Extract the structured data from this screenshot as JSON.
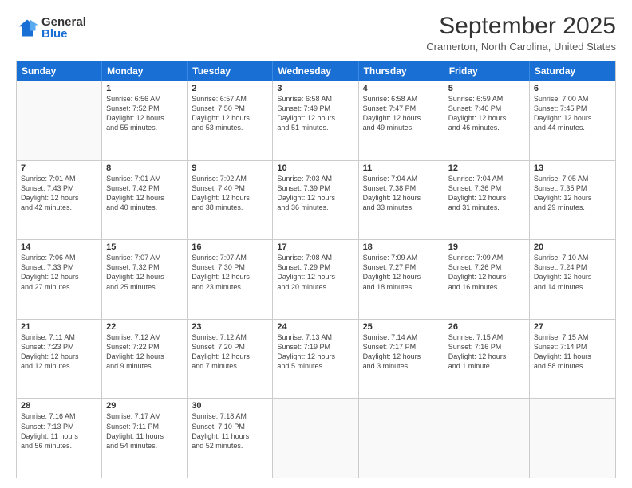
{
  "logo": {
    "general": "General",
    "blue": "Blue"
  },
  "title": "September 2025",
  "subtitle": "Cramerton, North Carolina, United States",
  "weekdays": [
    "Sunday",
    "Monday",
    "Tuesday",
    "Wednesday",
    "Thursday",
    "Friday",
    "Saturday"
  ],
  "weeks": [
    [
      {
        "day": "",
        "lines": []
      },
      {
        "day": "1",
        "lines": [
          "Sunrise: 6:56 AM",
          "Sunset: 7:52 PM",
          "Daylight: 12 hours",
          "and 55 minutes."
        ]
      },
      {
        "day": "2",
        "lines": [
          "Sunrise: 6:57 AM",
          "Sunset: 7:50 PM",
          "Daylight: 12 hours",
          "and 53 minutes."
        ]
      },
      {
        "day": "3",
        "lines": [
          "Sunrise: 6:58 AM",
          "Sunset: 7:49 PM",
          "Daylight: 12 hours",
          "and 51 minutes."
        ]
      },
      {
        "day": "4",
        "lines": [
          "Sunrise: 6:58 AM",
          "Sunset: 7:47 PM",
          "Daylight: 12 hours",
          "and 49 minutes."
        ]
      },
      {
        "day": "5",
        "lines": [
          "Sunrise: 6:59 AM",
          "Sunset: 7:46 PM",
          "Daylight: 12 hours",
          "and 46 minutes."
        ]
      },
      {
        "day": "6",
        "lines": [
          "Sunrise: 7:00 AM",
          "Sunset: 7:45 PM",
          "Daylight: 12 hours",
          "and 44 minutes."
        ]
      }
    ],
    [
      {
        "day": "7",
        "lines": [
          "Sunrise: 7:01 AM",
          "Sunset: 7:43 PM",
          "Daylight: 12 hours",
          "and 42 minutes."
        ]
      },
      {
        "day": "8",
        "lines": [
          "Sunrise: 7:01 AM",
          "Sunset: 7:42 PM",
          "Daylight: 12 hours",
          "and 40 minutes."
        ]
      },
      {
        "day": "9",
        "lines": [
          "Sunrise: 7:02 AM",
          "Sunset: 7:40 PM",
          "Daylight: 12 hours",
          "and 38 minutes."
        ]
      },
      {
        "day": "10",
        "lines": [
          "Sunrise: 7:03 AM",
          "Sunset: 7:39 PM",
          "Daylight: 12 hours",
          "and 36 minutes."
        ]
      },
      {
        "day": "11",
        "lines": [
          "Sunrise: 7:04 AM",
          "Sunset: 7:38 PM",
          "Daylight: 12 hours",
          "and 33 minutes."
        ]
      },
      {
        "day": "12",
        "lines": [
          "Sunrise: 7:04 AM",
          "Sunset: 7:36 PM",
          "Daylight: 12 hours",
          "and 31 minutes."
        ]
      },
      {
        "day": "13",
        "lines": [
          "Sunrise: 7:05 AM",
          "Sunset: 7:35 PM",
          "Daylight: 12 hours",
          "and 29 minutes."
        ]
      }
    ],
    [
      {
        "day": "14",
        "lines": [
          "Sunrise: 7:06 AM",
          "Sunset: 7:33 PM",
          "Daylight: 12 hours",
          "and 27 minutes."
        ]
      },
      {
        "day": "15",
        "lines": [
          "Sunrise: 7:07 AM",
          "Sunset: 7:32 PM",
          "Daylight: 12 hours",
          "and 25 minutes."
        ]
      },
      {
        "day": "16",
        "lines": [
          "Sunrise: 7:07 AM",
          "Sunset: 7:30 PM",
          "Daylight: 12 hours",
          "and 23 minutes."
        ]
      },
      {
        "day": "17",
        "lines": [
          "Sunrise: 7:08 AM",
          "Sunset: 7:29 PM",
          "Daylight: 12 hours",
          "and 20 minutes."
        ]
      },
      {
        "day": "18",
        "lines": [
          "Sunrise: 7:09 AM",
          "Sunset: 7:27 PM",
          "Daylight: 12 hours",
          "and 18 minutes."
        ]
      },
      {
        "day": "19",
        "lines": [
          "Sunrise: 7:09 AM",
          "Sunset: 7:26 PM",
          "Daylight: 12 hours",
          "and 16 minutes."
        ]
      },
      {
        "day": "20",
        "lines": [
          "Sunrise: 7:10 AM",
          "Sunset: 7:24 PM",
          "Daylight: 12 hours",
          "and 14 minutes."
        ]
      }
    ],
    [
      {
        "day": "21",
        "lines": [
          "Sunrise: 7:11 AM",
          "Sunset: 7:23 PM",
          "Daylight: 12 hours",
          "and 12 minutes."
        ]
      },
      {
        "day": "22",
        "lines": [
          "Sunrise: 7:12 AM",
          "Sunset: 7:22 PM",
          "Daylight: 12 hours",
          "and 9 minutes."
        ]
      },
      {
        "day": "23",
        "lines": [
          "Sunrise: 7:12 AM",
          "Sunset: 7:20 PM",
          "Daylight: 12 hours",
          "and 7 minutes."
        ]
      },
      {
        "day": "24",
        "lines": [
          "Sunrise: 7:13 AM",
          "Sunset: 7:19 PM",
          "Daylight: 12 hours",
          "and 5 minutes."
        ]
      },
      {
        "day": "25",
        "lines": [
          "Sunrise: 7:14 AM",
          "Sunset: 7:17 PM",
          "Daylight: 12 hours",
          "and 3 minutes."
        ]
      },
      {
        "day": "26",
        "lines": [
          "Sunrise: 7:15 AM",
          "Sunset: 7:16 PM",
          "Daylight: 12 hours",
          "and 1 minute."
        ]
      },
      {
        "day": "27",
        "lines": [
          "Sunrise: 7:15 AM",
          "Sunset: 7:14 PM",
          "Daylight: 11 hours",
          "and 58 minutes."
        ]
      }
    ],
    [
      {
        "day": "28",
        "lines": [
          "Sunrise: 7:16 AM",
          "Sunset: 7:13 PM",
          "Daylight: 11 hours",
          "and 56 minutes."
        ]
      },
      {
        "day": "29",
        "lines": [
          "Sunrise: 7:17 AM",
          "Sunset: 7:11 PM",
          "Daylight: 11 hours",
          "and 54 minutes."
        ]
      },
      {
        "day": "30",
        "lines": [
          "Sunrise: 7:18 AM",
          "Sunset: 7:10 PM",
          "Daylight: 11 hours",
          "and 52 minutes."
        ]
      },
      {
        "day": "",
        "lines": []
      },
      {
        "day": "",
        "lines": []
      },
      {
        "day": "",
        "lines": []
      },
      {
        "day": "",
        "lines": []
      }
    ]
  ]
}
